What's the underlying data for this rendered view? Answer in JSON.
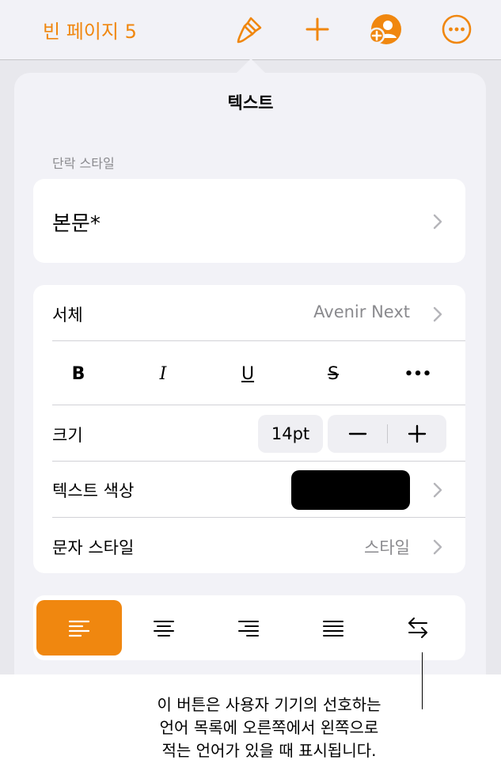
{
  "toolbar": {
    "doc_title": "빈 페이지 5",
    "icons": [
      "paintbrush-icon",
      "plus-icon",
      "add-person-icon",
      "more-icon"
    ],
    "accent_color": "#f0870f"
  },
  "popover": {
    "title": "텍스트",
    "paragraph_style_label": "단락 스타일",
    "paragraph_style_value": "본문*",
    "font_label": "서체",
    "font_value": "Avenir Next",
    "format_buttons": [
      "B",
      "I",
      "U",
      "S",
      "•••"
    ],
    "size_label": "크기",
    "size_value": "14pt",
    "stepper_minus": "−",
    "stepper_plus": "+",
    "text_color_label": "텍스트 색상",
    "text_color_value": "#000000",
    "char_style_label": "문자 스타일",
    "char_style_value": "스타일",
    "alignment_buttons": [
      "align-left-icon",
      "align-center-icon",
      "align-right-icon",
      "justify-icon",
      "rtl-direction-icon"
    ],
    "active_alignment": "align-left"
  },
  "caption": {
    "line1": "이 버튼은 사용자 기기의 선호하는",
    "line2": "언어 목록에 오른쪽에서 왼쪽으로",
    "line3": "적는 언어가 있을 때 표시됩니다."
  }
}
